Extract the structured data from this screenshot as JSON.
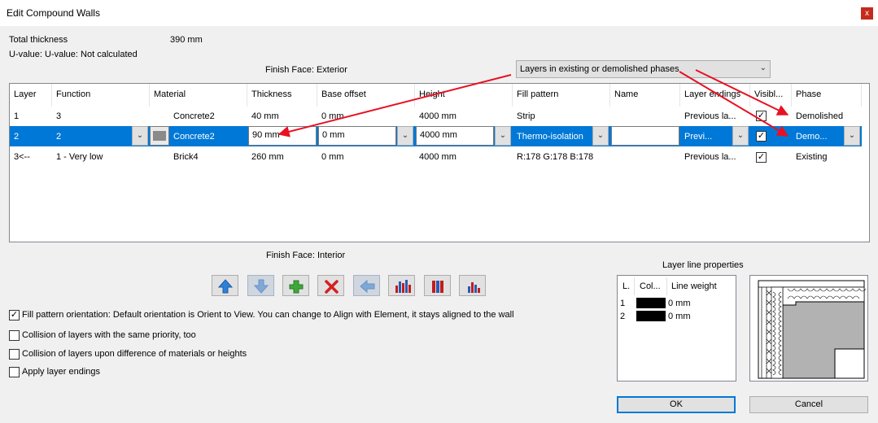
{
  "window": {
    "title": "Edit Compound Walls",
    "close_label": "x"
  },
  "info": {
    "total_thickness_label": "Total thickness",
    "total_thickness_value": "390 mm",
    "u_value_text": "U-value: U-value: Not calculated"
  },
  "finish_face_exterior": "Finish Face: Exterior",
  "finish_face_interior": "Finish Face: Interior",
  "phase_filter": {
    "selected": "Layers in existing or demolished phases"
  },
  "columns": [
    "Layer",
    "Function",
    "Material",
    "Thickness",
    "Base offset",
    "Height",
    "Fill pattern",
    "Name",
    "Layer endings",
    "Visibl...",
    "Phase"
  ],
  "rows": [
    {
      "layer": "1",
      "function": "3",
      "material": "Concrete2",
      "thickness": "40 mm",
      "base_offset": "0 mm",
      "height": "4000 mm",
      "fill": "Strip",
      "name": "",
      "endings": "Previous la...",
      "visible": true,
      "phase": "Demolished"
    },
    {
      "layer": "2",
      "function": "2",
      "material": "Concrete2",
      "thickness": "90 mm",
      "base_offset": "0 mm",
      "height": "4000 mm",
      "fill": "Thermo-isolation",
      "name": "",
      "endings": "Previ...",
      "visible": true,
      "phase": "Demo..."
    },
    {
      "layer": "3<--",
      "function": "1 - Very low",
      "material": "Brick4",
      "thickness": "260 mm",
      "base_offset": "0 mm",
      "height": "4000 mm",
      "fill": "R:178 G:178 B:178",
      "name": "",
      "endings": "Previous la...",
      "visible": true,
      "phase": "Existing"
    }
  ],
  "toolbar": [
    "arrow-up-icon",
    "arrow-down-icon",
    "add-layer-icon",
    "delete-layer-icon",
    "arrow-left-icon",
    "layers-chart-icon",
    "layers-columns-icon",
    "layers-bars-icon"
  ],
  "options": [
    {
      "label": "Fill pattern orientation: Default orientation is Orient to View. You can change to Align with Element, it stays aligned to the wall",
      "checked": true
    },
    {
      "label": "Collision of layers with the same priority, too",
      "checked": false
    },
    {
      "label": "Collision of layers upon difference of materials or heights",
      "checked": false
    },
    {
      "label": "Apply layer endings",
      "checked": false
    }
  ],
  "layer_line_properties": {
    "title": "Layer line properties",
    "headers": [
      "L.",
      "Col...",
      "Line weight"
    ],
    "rows": [
      {
        "l": "1",
        "weight": "0 mm"
      },
      {
        "l": "2",
        "weight": "0 mm"
      }
    ]
  },
  "buttons": {
    "ok": "OK",
    "cancel": "Cancel"
  },
  "colors": {
    "selection": "#0078d7",
    "annotation_arrow": "#e81123"
  }
}
